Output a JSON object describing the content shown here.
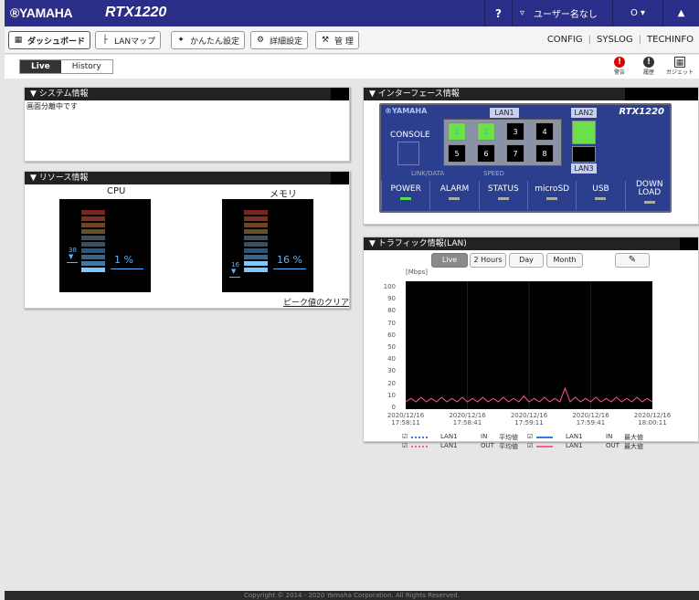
{
  "topbar": {
    "logo": "®YAMAHA",
    "model": "RTX1220",
    "help": "?",
    "user": "ユーザー名なし",
    "power": "O ▾",
    "bell": "▲"
  },
  "nav": {
    "tabs": [
      {
        "label": "ダッシュボード",
        "icon": "dashboard-icon"
      },
      {
        "label": "LANマップ",
        "icon": "lanmap-icon"
      },
      {
        "label": "かんたん設定",
        "icon": "wizard-icon"
      },
      {
        "label": "詳細設定",
        "icon": "gear-icon"
      },
      {
        "label": "管 理",
        "icon": "wrench-icon"
      }
    ],
    "right_links": [
      "CONFIG",
      "SYSLOG",
      "TECHINFO"
    ]
  },
  "subtabs": {
    "live": "Live",
    "history": "History"
  },
  "right_icons": [
    {
      "label": "警告",
      "icon": "alert-icon"
    },
    {
      "label": "履歴",
      "icon": "history-alert-icon"
    },
    {
      "label": "ガジェット",
      "icon": "gadget-icon"
    }
  ],
  "system": {
    "title": "システム情報",
    "message": "画面分離中です"
  },
  "resource": {
    "title": "リソース情報",
    "cpu": {
      "label": "CPU",
      "peak": "38",
      "value": "1 %",
      "level": 0.01,
      "peak_level": 0.38
    },
    "memory": {
      "label": "メモリ",
      "peak": "16",
      "value": "16 %",
      "level": 0.16,
      "peak_level": 0.16
    },
    "clear_link": "ピーク値のクリア"
  },
  "interface": {
    "title": "インターフェース情報",
    "brand": "®YAMAHA",
    "model": "RTX1220",
    "console": "CONSOLE",
    "lan1": "LAN1",
    "lan2": "LAN2",
    "lan3": "LAN3",
    "link_data": "LINK/DATA",
    "speed": "SPEED",
    "ports": [
      "1",
      "2",
      "3",
      "4",
      "5",
      "6",
      "7",
      "8"
    ],
    "ports_active": [
      true,
      true,
      false,
      false,
      false,
      false,
      false,
      false
    ],
    "leds": [
      {
        "label": "POWER",
        "on": true
      },
      {
        "label": "ALARM",
        "on": false
      },
      {
        "label": "STATUS",
        "on": false
      },
      {
        "label": "microSD",
        "on": false
      },
      {
        "label": "USB",
        "on": false
      },
      {
        "label": "DOWN\nLOAD",
        "on": false
      }
    ]
  },
  "traffic": {
    "title": "トラフィック情報(LAN)",
    "buttons": [
      "Live",
      "2 Hours",
      "Day",
      "Month"
    ],
    "edit_icon": "pencil-icon",
    "unit": "[Mbps]",
    "yticks": [
      "100",
      "90",
      "80",
      "70",
      "60",
      "50",
      "40",
      "30",
      "20",
      "10",
      "0"
    ],
    "xticks": [
      [
        "2020/12/16",
        "17:58:11"
      ],
      [
        "2020/12/16",
        "17:58:41"
      ],
      [
        "2020/12/16",
        "17:59:11"
      ],
      [
        "2020/12/16",
        "17:59:41"
      ],
      [
        "2020/12/16",
        "18:00:11"
      ]
    ],
    "legend": [
      [
        {
          "check": "☑",
          "line": "dotted-blue",
          "port": "LAN1",
          "dir": "IN",
          "kind": "平均値"
        },
        {
          "check": "☑",
          "line": "solid-blue",
          "port": "LAN1",
          "dir": "IN",
          "kind": "最大値"
        }
      ],
      [
        {
          "check": "☑",
          "line": "dotted-pink",
          "port": "LAN1",
          "dir": "OUT",
          "kind": "平均値"
        },
        {
          "check": "☑",
          "line": "solid-pink",
          "port": "LAN1",
          "dir": "OUT",
          "kind": "最大値"
        }
      ]
    ]
  },
  "chart_data": {
    "type": "line",
    "ylabel": "[Mbps]",
    "ylim": [
      0,
      100
    ],
    "x": [
      "17:58:11",
      "17:58:41",
      "17:59:11",
      "17:59:41",
      "18:00:11"
    ],
    "series": [
      {
        "values": [
          0,
          3,
          0,
          4,
          0,
          3,
          0,
          4,
          0,
          3,
          0,
          4,
          0,
          3,
          0,
          4,
          0,
          3,
          0,
          4,
          0,
          3,
          0,
          5,
          0,
          3,
          0,
          4,
          0,
          3,
          0,
          12,
          0,
          4,
          0,
          3,
          0,
          4,
          0,
          3,
          0,
          4,
          0,
          3,
          0,
          4,
          0,
          3,
          0
        ]
      }
    ]
  },
  "footer": "Copyright © 2014 - 2020 Yamaha Corporation. All Rights Reserved.",
  "colors": {
    "topbar": "#2a2e89",
    "active_port": "#6be04a",
    "chart_bg": "#000000",
    "series": "#ff5a8c",
    "gauge_value": "#5ab4ff"
  }
}
